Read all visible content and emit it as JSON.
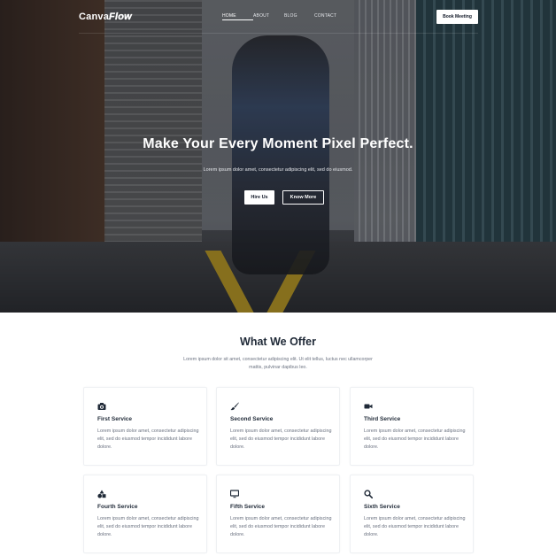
{
  "brand": {
    "name_main": "Canva",
    "name_accent": "Flow"
  },
  "nav": {
    "items": [
      {
        "label": "HOME",
        "active": true
      },
      {
        "label": "ABOUT",
        "active": false
      },
      {
        "label": "BLOG",
        "active": false
      },
      {
        "label": "CONTACT",
        "active": false
      }
    ],
    "cta_label": "Book Meeting"
  },
  "hero": {
    "title": "Make Your Every Moment Pixel Perfect.",
    "subtitle": "Lorem ipsum dolor amet, consectetur adipiscing elit, sed do eiusmod.",
    "primary_button": "Hire Us",
    "secondary_button": "Know More"
  },
  "offer": {
    "title": "What We Offer",
    "description": "Lorem ipsum dolor sit amet, consectetur adipiscing elit. Ut elit tellus, luctus nec ullamcorper mattis, pulvinar dapibus leo.",
    "services": [
      {
        "icon": "camera-icon",
        "title": "First Service",
        "text": "Lorem ipsum dolor amet, consectetur adipiscing elit, sed do eiusmod tempor incididunt labore dolore."
      },
      {
        "icon": "brush-icon",
        "title": "Second Service",
        "text": "Lorem ipsum dolor amet, consectetur adipiscing elit, sed do eiusmod tempor incididunt labore dolore."
      },
      {
        "icon": "video-icon",
        "title": "Third Service",
        "text": "Lorem ipsum dolor amet, consectetur adipiscing elit, sed do eiusmod tempor incididunt labore dolore."
      },
      {
        "icon": "shapes-icon",
        "title": "Fourth Service",
        "text": "Lorem ipsum dolor amet, consectetur adipiscing elit, sed do eiusmod tempor incididunt labore dolore."
      },
      {
        "icon": "monitor-icon",
        "title": "Fifth Service",
        "text": "Lorem ipsum dolor amet, consectetur adipiscing elit, sed do eiusmod tempor incididunt labore dolore."
      },
      {
        "icon": "search-icon",
        "title": "Sixth Service",
        "text": "Lorem ipsum dolor amet, consectetur adipiscing elit, sed do eiusmod tempor incididunt labore dolore."
      }
    ]
  },
  "colors": {
    "accent_dark": "#1f2937",
    "body_text": "#6b7280",
    "hero_overlay": "#0a0c10"
  }
}
